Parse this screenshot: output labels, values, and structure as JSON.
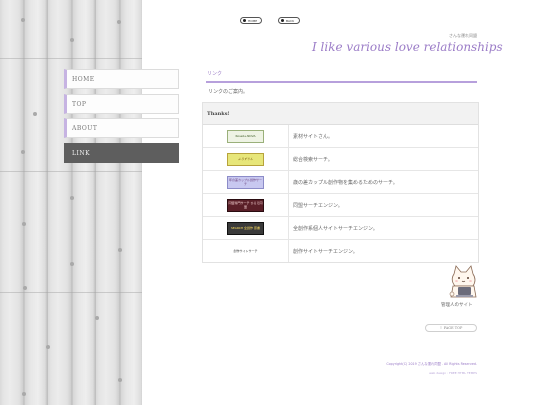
{
  "header": {
    "nav_buttons": [
      {
        "label": "HOME"
      },
      {
        "label": "BACK"
      }
    ],
    "site_name": "さんな運れ同盟",
    "tagline": "I like various love relationships"
  },
  "sidebar": {
    "items": [
      {
        "label": "HOME"
      },
      {
        "label": "TOP"
      },
      {
        "label": "ABOUT"
      },
      {
        "label": "LINK"
      }
    ]
  },
  "main": {
    "section_title": "リンク",
    "intro": "リンクのご案内。",
    "table_header": "Thanks!",
    "links": [
      {
        "banner_text": "Roseb+NOVA",
        "description": "素材サイトさん。"
      },
      {
        "banner_text": "よろずりん",
        "description": "総合検索サーチ。"
      },
      {
        "banner_text": "年の差カップル創作サーチ",
        "description": "歳の差カップル創作物を集めるためのサーチ。"
      },
      {
        "banner_text": "同盟専門サーチ ひらえ同盟",
        "description": "同盟サーチエンジン。"
      },
      {
        "banner_text": "SEARCH 全創作 原書",
        "description": "全創作系個人サイトサーチエンジン。"
      },
      {
        "banner_text": "創作サイトサーチ",
        "description": "創作サイトサーチエンジン。"
      }
    ]
  },
  "admin": {
    "label": "管理人のサイト"
  },
  "page_top": "↑ PAGE TOP",
  "footer": {
    "copyright": "Copyright(C) 2019 さんな運れ同盟 . All Rights Reserved.",
    "credit": "web design : FREE HTML TEMPS"
  },
  "colors": {
    "accent": "#9b7cc7",
    "nav_active_bg": "#5e5e5e"
  }
}
